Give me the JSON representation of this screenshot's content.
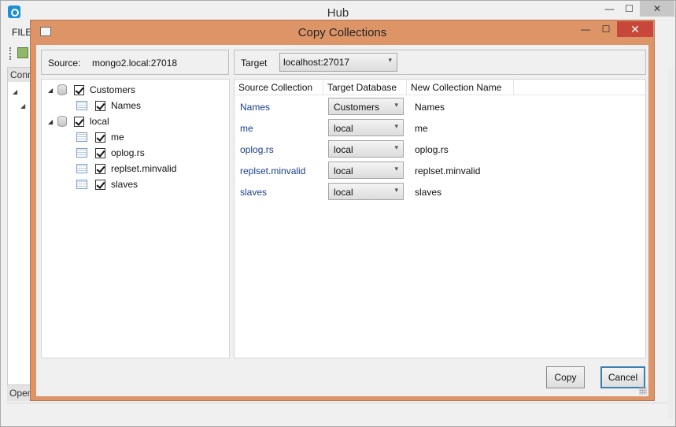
{
  "main_window": {
    "title": "Hub",
    "menu": {
      "file": "FILE"
    },
    "panel_header": "Connections",
    "status_left": "Open",
    "controls": {
      "minimize": "—",
      "maximize": "☐",
      "close": "✕"
    }
  },
  "dialog": {
    "title": "Copy Collections",
    "controls": {
      "minimize": "—",
      "maximize": "☐",
      "close": "✕"
    },
    "source": {
      "label": "Source:",
      "value": "mongo2.local:27018"
    },
    "target": {
      "label": "Target",
      "value": "localhost:27017"
    },
    "tree": [
      {
        "label": "Customers",
        "checked": true,
        "children": [
          {
            "label": "Names",
            "checked": true
          }
        ]
      },
      {
        "label": "local",
        "checked": true,
        "children": [
          {
            "label": "me",
            "checked": true
          },
          {
            "label": "oplog.rs",
            "checked": true
          },
          {
            "label": "replset.minvalid",
            "checked": true
          },
          {
            "label": "slaves",
            "checked": true
          }
        ]
      }
    ],
    "grid": {
      "columns": [
        "Source Collection",
        "Target Database",
        "New Collection Name"
      ],
      "rows": [
        {
          "source": "Names",
          "target_db": "Customers",
          "new_name": "Names"
        },
        {
          "source": "me",
          "target_db": "local",
          "new_name": "me"
        },
        {
          "source": "oplog.rs",
          "target_db": "local",
          "new_name": "oplog.rs"
        },
        {
          "source": "replset.minvalid",
          "target_db": "local",
          "new_name": "replset.minvalid"
        },
        {
          "source": "slaves",
          "target_db": "local",
          "new_name": "slaves"
        }
      ]
    },
    "buttons": {
      "copy": "Copy",
      "cancel": "Cancel"
    },
    "accent_color": "#dd9568",
    "close_button_color": "#c7483a"
  }
}
